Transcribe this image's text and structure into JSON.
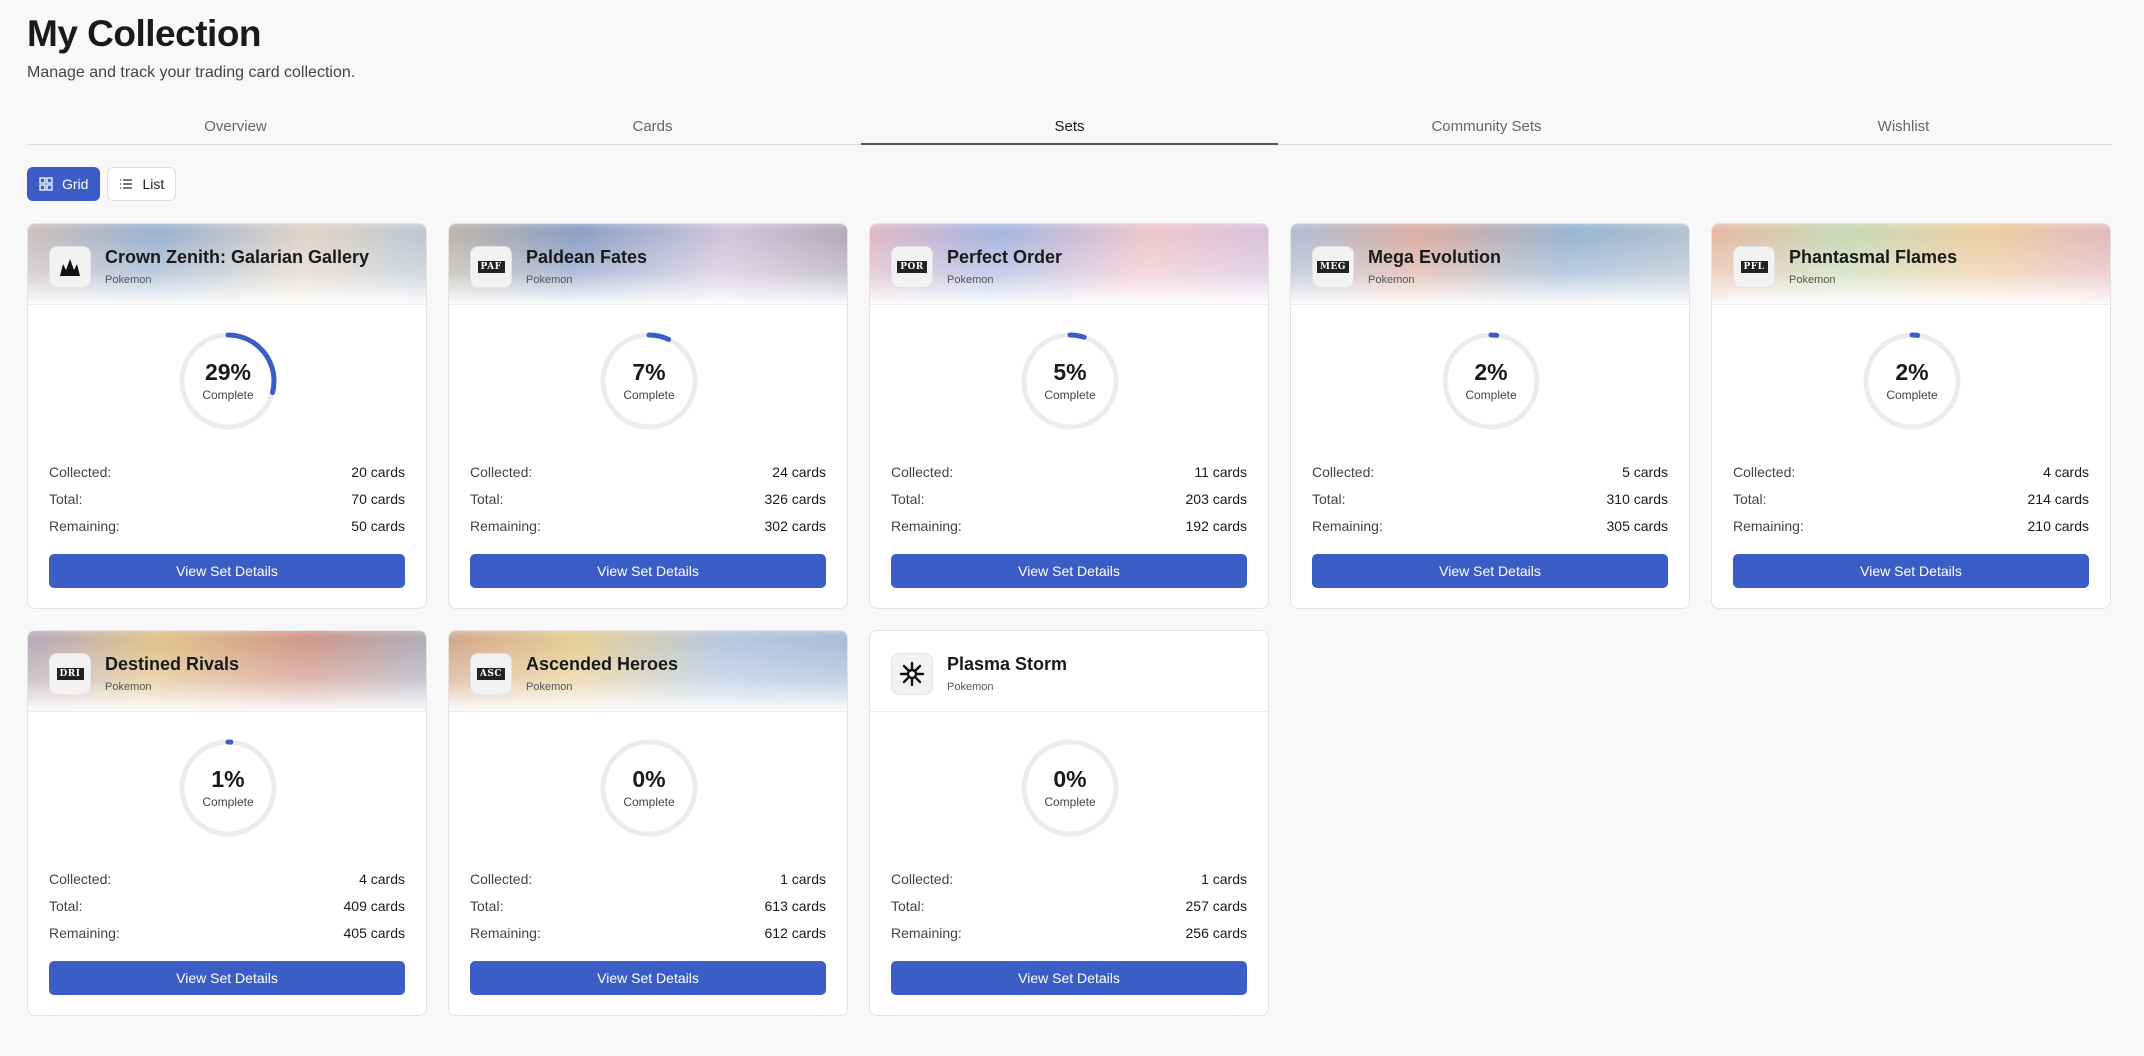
{
  "header": {
    "title": "My Collection",
    "subtitle": "Manage and track your trading card collection."
  },
  "tabs": [
    {
      "label": "Overview",
      "active": false
    },
    {
      "label": "Cards",
      "active": false
    },
    {
      "label": "Sets",
      "active": true
    },
    {
      "label": "Community Sets",
      "active": false
    },
    {
      "label": "Wishlist",
      "active": false
    }
  ],
  "view_toggle": {
    "grid_label": "Grid",
    "list_label": "List",
    "active": "grid"
  },
  "labels": {
    "collected": "Collected:",
    "total": "Total:",
    "remaining": "Remaining:",
    "complete": "Complete",
    "view_details": "View Set Details"
  },
  "colors": {
    "accent": "#3b5ec6",
    "ring_track": "#ececec"
  },
  "sets": [
    {
      "name": "Crown Zenith: Galarian Gallery",
      "game": "Pokemon",
      "logo": "CZ",
      "logo_icon": "crown-zenith-icon",
      "percent": 29,
      "percent_label": "29%",
      "collected": "20 cards",
      "total": "70 cards",
      "remaining": "50 cards",
      "banner": [
        "#c9b2a6",
        "#7f9ec4",
        "#d9c9b8",
        "#9fb3c8"
      ]
    },
    {
      "name": "Paldean Fates",
      "game": "Pokemon",
      "logo": "PAF",
      "logo_icon": "paf-code-icon",
      "percent": 7,
      "percent_label": "7%",
      "collected": "24 cards",
      "total": "326 cards",
      "remaining": "302 cards",
      "banner": [
        "#b7a78f",
        "#6d86b7",
        "#c4b7d2",
        "#928c9a"
      ]
    },
    {
      "name": "Perfect Order",
      "game": "Pokemon",
      "logo": "POR",
      "logo_icon": "por-code-icon",
      "percent": 5,
      "percent_label": "5%",
      "collected": "11 cards",
      "total": "203 cards",
      "remaining": "192 cards",
      "banner": [
        "#e4a7b3",
        "#8fa3d9",
        "#eab7c0",
        "#c5b1d5"
      ]
    },
    {
      "name": "Mega Evolution",
      "game": "Pokemon",
      "logo": "MEG",
      "logo_icon": "meg-code-icon",
      "percent": 2,
      "percent_label": "2%",
      "collected": "5 cards",
      "total": "310 cards",
      "remaining": "305 cards",
      "banner": [
        "#8fb0d4",
        "#d49a8a",
        "#7da2c6",
        "#a8b6c2"
      ]
    },
    {
      "name": "Phantasmal Flames",
      "game": "Pokemon",
      "logo": "PFL",
      "logo_icon": "pfl-code-icon",
      "percent": 2,
      "percent_label": "2%",
      "collected": "4 cards",
      "total": "214 cards",
      "remaining": "210 cards",
      "banner": [
        "#e7a089",
        "#b8d0a3",
        "#e7c08a",
        "#d9a0b4"
      ]
    },
    {
      "name": "Destined Rivals",
      "game": "Pokemon",
      "logo": "DRI",
      "logo_icon": "dri-code-icon",
      "percent": 1,
      "percent_label": "1%",
      "collected": "4 cards",
      "total": "409 cards",
      "remaining": "405 cards",
      "banner": [
        "#9a8fb4",
        "#d9b46e",
        "#c47c6b",
        "#8f9fb8"
      ]
    },
    {
      "name": "Ascended Heroes",
      "game": "Pokemon",
      "logo": "ASC",
      "logo_icon": "asc-code-icon",
      "percent": 0,
      "percent_label": "0%",
      "collected": "1 cards",
      "total": "613 cards",
      "remaining": "612 cards",
      "banner": [
        "#c48a6e",
        "#e0c27a",
        "#a3b9d9",
        "#8fa8c8"
      ]
    },
    {
      "name": "Plasma Storm",
      "game": "Pokemon",
      "logo": "PS",
      "logo_icon": "plasma-storm-icon",
      "percent": 0,
      "percent_label": "0%",
      "collected": "1 cards",
      "total": "257 cards",
      "remaining": "256 cards",
      "banner": []
    }
  ]
}
